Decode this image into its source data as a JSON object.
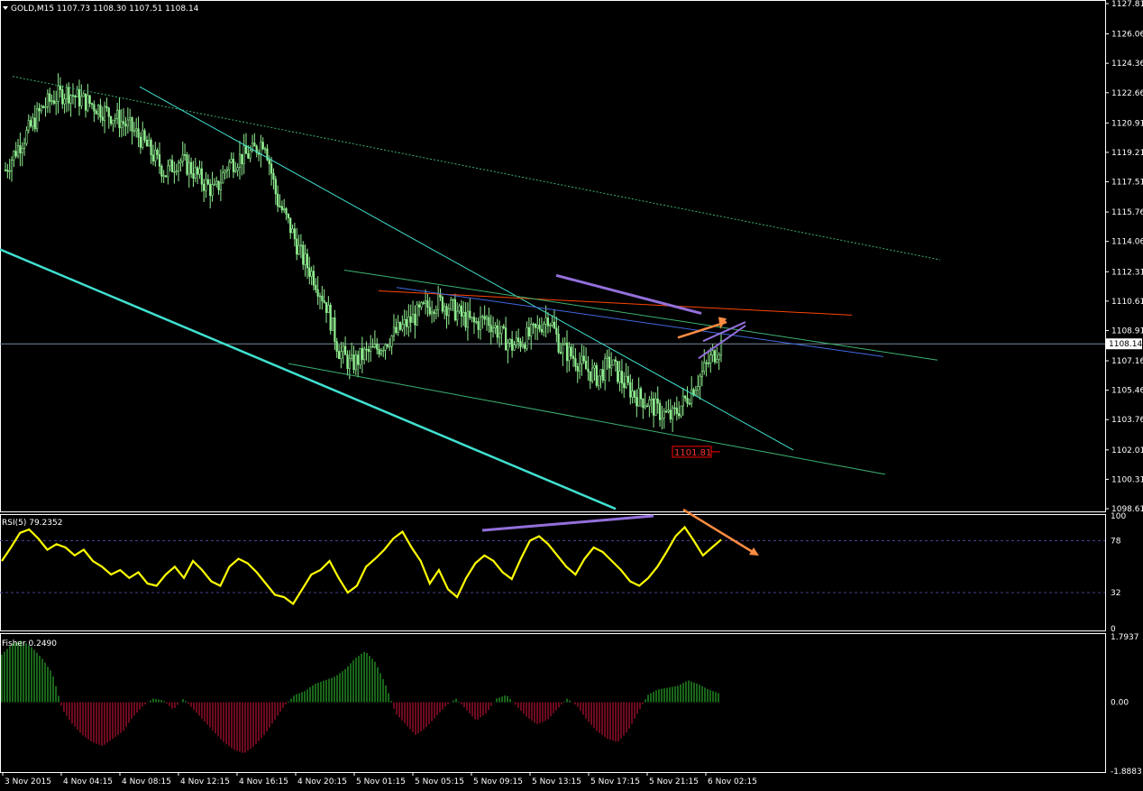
{
  "chart_data": [
    {
      "type": "candlestick",
      "title": "GOLD,M15 1107.73 1108.30 1107.51 1108.14",
      "symbol": "GOLD",
      "timeframe": "M15",
      "ohlc_last": {
        "open": 1107.73,
        "high": 1108.3,
        "low": 1107.51,
        "close": 1108.14
      },
      "ylim": [
        1098.61,
        1127.81
      ],
      "yticks": [
        1127.81,
        1126.06,
        1124.36,
        1122.66,
        1120.91,
        1119.21,
        1117.51,
        1115.76,
        1114.06,
        1112.31,
        1110.61,
        1108.91,
        1107.16,
        1105.46,
        1103.76,
        1102.01,
        1100.31,
        1098.61
      ],
      "current_price_label": "1108.14",
      "marker_label": "1101.81",
      "xticks": [
        "3 Nov 2015",
        "4 Nov 04:15",
        "4 Nov 08:15",
        "4 Nov 12:15",
        "4 Nov 16:15",
        "4 Nov 20:15",
        "5 Nov 01:15",
        "5 Nov 05:15",
        "5 Nov 09:15",
        "5 Nov 13:15",
        "5 Nov 17:15",
        "5 Nov 21:15",
        "6 Nov 02:15"
      ],
      "close_path": [
        1118.2,
        1119.5,
        1120.6,
        1121.8,
        1122.4,
        1122.7,
        1122.3,
        1122.0,
        1121.6,
        1121.2,
        1120.7,
        1120.0,
        1119.0,
        1118.0,
        1118.8,
        1118.3,
        1117.5,
        1116.9,
        1118.5,
        1118.9,
        1119.2,
        1120.0,
        1116.5,
        1115.0,
        1113.2,
        1112.0,
        1110.4,
        1107.8,
        1106.9,
        1107.5,
        1107.8,
        1108.4,
        1109.0,
        1109.6,
        1110.2,
        1110.6,
        1110.3,
        1109.7,
        1109.3,
        1109.6,
        1108.8,
        1108.0,
        1108.4,
        1108.9,
        1109.8,
        1107.9,
        1107.4,
        1106.7,
        1106.2,
        1107.1,
        1106.0,
        1105.2,
        1104.8,
        1104.2,
        1103.9,
        1104.8,
        1105.9,
        1107.1,
        1108.14
      ],
      "colors": {
        "candles": "#90ee90",
        "background": "#000000",
        "axis": "#ffffff"
      },
      "series": [
        {
          "name": "trendline-upper-dotted",
          "color": "#3cb371",
          "style": "dotted"
        },
        {
          "name": "channel-thin",
          "color": "#40e0d0"
        },
        {
          "name": "channel-thick",
          "color": "#40e0d0"
        },
        {
          "name": "resistance-red",
          "color": "#ff4500"
        },
        {
          "name": "resistance-blue",
          "color": "#4169e1"
        },
        {
          "name": "resistance-green",
          "color": "#3cb371"
        },
        {
          "name": "support-green",
          "color": "#3cb371"
        },
        {
          "name": "divergence-purple",
          "color": "#9370db"
        },
        {
          "name": "arrow-orange",
          "color": "#ff8c42"
        }
      ]
    },
    {
      "type": "line",
      "title": "RSI(5) 79.2352",
      "ylim": [
        0,
        100
      ],
      "yticks": [
        100,
        78,
        32,
        0
      ],
      "levels": [
        78,
        32
      ],
      "color": "#ffff00",
      "values": [
        60,
        72,
        85,
        88,
        80,
        70,
        75,
        72,
        65,
        70,
        60,
        55,
        48,
        52,
        45,
        50,
        40,
        38,
        48,
        55,
        45,
        60,
        52,
        42,
        38,
        55,
        62,
        58,
        50,
        40,
        30,
        28,
        22,
        35,
        48,
        52,
        60,
        45,
        32,
        38,
        55,
        62,
        70,
        80,
        86,
        72,
        60,
        40,
        52,
        35,
        28,
        45,
        58,
        65,
        60,
        50,
        44,
        62,
        78,
        82,
        75,
        65,
        55,
        48,
        62,
        72,
        68,
        60,
        52,
        42,
        38,
        45,
        55,
        68,
        82,
        90,
        78,
        65,
        72,
        79
      ]
    },
    {
      "type": "bar",
      "title": "Fisher 0.2490",
      "ylim": [
        -1.8883,
        1.7937
      ],
      "yticks": [
        1.7937,
        0.0,
        -1.8883
      ],
      "colors": {
        "positive": "#32cd32",
        "negative": "#dc143c"
      },
      "values": [
        1.3,
        1.6,
        1.7,
        1.5,
        1.2,
        0.8,
        -0.2,
        -0.6,
        -0.9,
        -1.1,
        -1.2,
        -1.0,
        -0.8,
        -0.4,
        -0.1,
        0.1,
        0.05,
        -0.2,
        0.1,
        -0.2,
        -0.5,
        -0.8,
        -1.1,
        -1.3,
        -1.4,
        -1.2,
        -0.9,
        -0.5,
        -0.1,
        0.2,
        0.3,
        0.5,
        0.6,
        0.7,
        0.9,
        1.2,
        1.4,
        1.1,
        0.5,
        -0.3,
        -0.6,
        -0.9,
        -0.7,
        -0.4,
        -0.1,
        0.1,
        -0.2,
        -0.5,
        -0.3,
        0.1,
        0.2,
        -0.1,
        -0.4,
        -0.6,
        -0.5,
        -0.2,
        0.1,
        -0.1,
        -0.5,
        -0.8,
        -1.0,
        -1.1,
        -0.8,
        -0.3,
        0.2,
        0.35,
        0.4,
        0.45,
        0.6,
        0.5,
        0.35,
        0.25
      ]
    }
  ]
}
